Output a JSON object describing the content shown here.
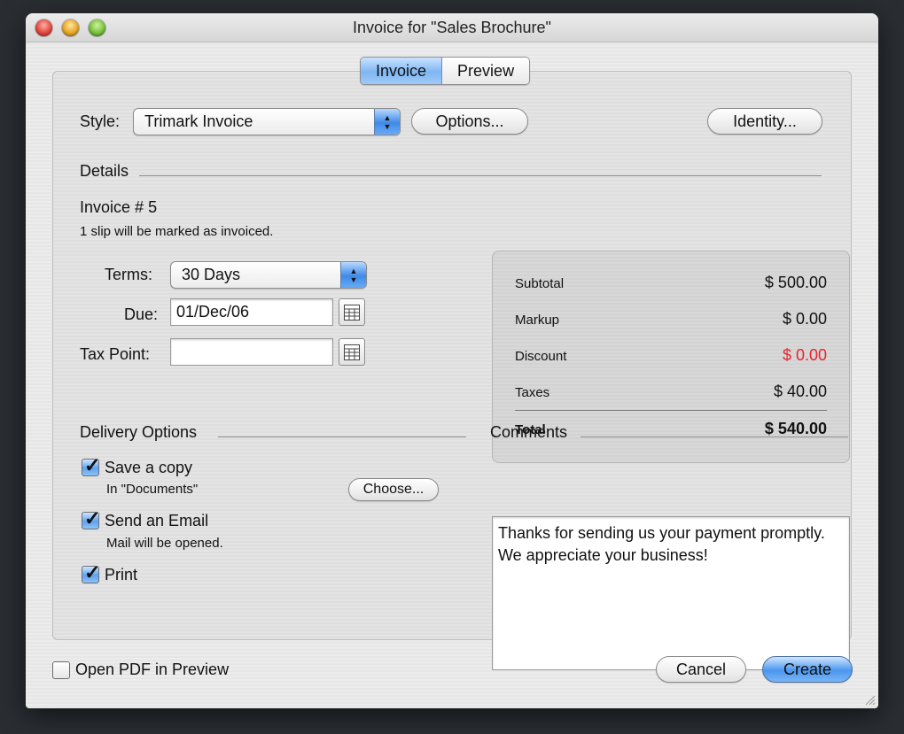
{
  "window": {
    "title": "Invoice for \"Sales Brochure\""
  },
  "tabs": [
    {
      "label": "Invoice",
      "active": true
    },
    {
      "label": "Preview",
      "active": false
    }
  ],
  "style_row": {
    "label": "Style:",
    "selected": "Trimark Invoice",
    "options_button": "Options...",
    "identity_button": "Identity..."
  },
  "details": {
    "heading": "Details",
    "invoice_label": "Invoice #",
    "invoice_number": "5",
    "slip_note": "1 slip will be marked as invoiced.",
    "terms_label": "Terms:",
    "terms_value": "30 Days",
    "due_label": "Due:",
    "due_value": "01/Dec/06",
    "tax_point_label": "Tax Point:",
    "tax_point_value": ""
  },
  "summary": {
    "subtotal_label": "Subtotal",
    "subtotal_value": "$ 500.00",
    "markup_label": "Markup",
    "markup_value": "$ 0.00",
    "discount_label": "Discount",
    "discount_value": "$ 0.00",
    "taxes_label": "Taxes",
    "taxes_value": "$ 40.00",
    "total_label": "Total",
    "total_value": "$ 540.00",
    "discount_color": "#e8232c"
  },
  "delivery": {
    "heading": "Delivery Options",
    "save_copy_label": "Save a copy",
    "save_copy_note": "In \"Documents\"",
    "choose_button": "Choose...",
    "send_email_label": "Send an Email",
    "send_email_note": "Mail will be opened.",
    "print_label": "Print",
    "save_copy_checked": true,
    "send_email_checked": true,
    "print_checked": true
  },
  "comments": {
    "heading": "Comments",
    "text": "Thanks for sending us your payment promptly. We appreciate your business!"
  },
  "footer": {
    "open_pdf_label": "Open PDF in Preview",
    "open_pdf_checked": false,
    "cancel_button": "Cancel",
    "create_button": "Create"
  },
  "colors": {
    "accent": "#4b96ee",
    "window_bg": "#ececec",
    "desktop_bg": "#2a2e33"
  }
}
